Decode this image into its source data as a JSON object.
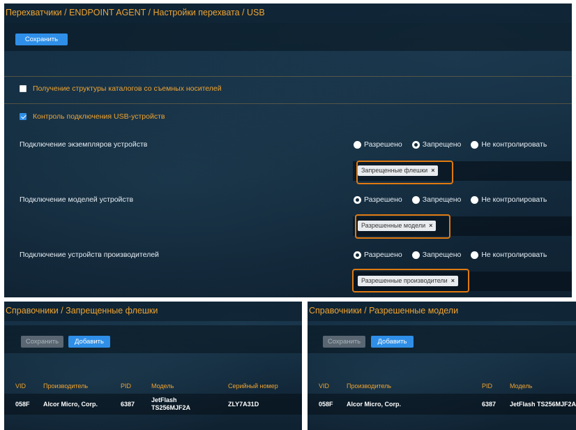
{
  "main": {
    "breadcrumb": "Перехватчики / ENDPOINT AGENT / Настройки перехвата / USB",
    "save_label": "Сохранить",
    "directory_structure": {
      "label": "Получение структуры каталогов со съемных носителей",
      "checked": false
    },
    "usb_control": {
      "label": "Контроль подключения USB-устройств",
      "checked": true
    },
    "radio_labels": {
      "allowed": "Разрешено",
      "forbidden": "Запрещено",
      "not_controlled": "Не контролировать"
    },
    "settings": [
      {
        "label": "Подключение экземпляров устройств",
        "selected": "forbidden",
        "tag": "Запрещенные флешки"
      },
      {
        "label": "Подключение моделей устройств",
        "selected": "allowed",
        "tag": "Разрешенные модели"
      },
      {
        "label": "Подключение устройств производителей",
        "selected": "allowed",
        "tag": "Разрешенные производители"
      }
    ]
  },
  "flash_panel": {
    "breadcrumb": "Справочники / Запрещенные флешки",
    "save_label": "Сохранить",
    "add_label": "Добавить",
    "columns": [
      "VID",
      "Производитель",
      "PID",
      "Модель",
      "Серийный номер"
    ],
    "rows": [
      {
        "vid": "058F",
        "manufacturer": "Alcor Micro, Corp.",
        "pid": "6387",
        "model_line1": "JetFlash",
        "model_line2": "TS256MJF2A",
        "serial": "ZLY7A31D"
      }
    ]
  },
  "models_panel": {
    "breadcrumb": "Справочники / Разрешенные модели",
    "save_label": "Сохранить",
    "add_label": "Добавить",
    "columns": [
      "VID",
      "Производитель",
      "PID",
      "Модель"
    ],
    "rows": [
      {
        "vid": "058F",
        "manufacturer": "Alcor Micro, Corp.",
        "pid": "6387",
        "model": "JetFlash TS256MJF2A"
      }
    ]
  },
  "colors": {
    "accent_orange": "#f0a431",
    "highlight_orange": "#e07a10",
    "button_blue": "#2f8fe8",
    "panel_bg": "#12293b"
  }
}
